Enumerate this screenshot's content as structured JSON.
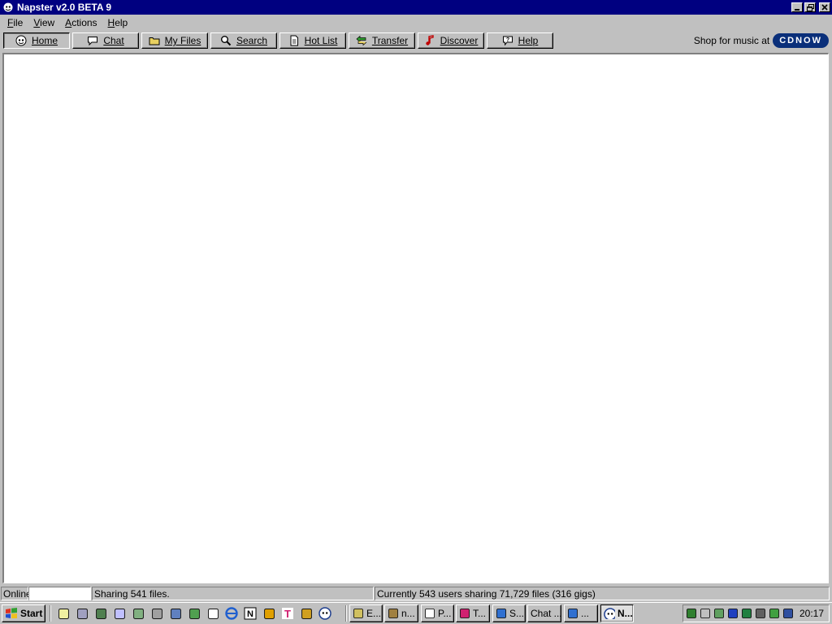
{
  "window": {
    "title": "Napster v2.0 BETA 9",
    "controls": [
      "minimize",
      "restore",
      "close"
    ]
  },
  "menu": [
    {
      "label": "File",
      "mnemonic": "F"
    },
    {
      "label": "View",
      "mnemonic": "V"
    },
    {
      "label": "Actions",
      "mnemonic": "A"
    },
    {
      "label": "Help",
      "mnemonic": "H"
    }
  ],
  "toolbar": {
    "buttons": [
      {
        "label": "Home",
        "icon": "napster-cat-icon",
        "active": true
      },
      {
        "label": "Chat",
        "icon": "speech-bubble-icon",
        "active": false
      },
      {
        "label": "My Files",
        "icon": "folder-icon",
        "active": false
      },
      {
        "label": "Search",
        "icon": "magnifier-icon",
        "active": false
      },
      {
        "label": "Hot List",
        "icon": "document-icon",
        "active": false
      },
      {
        "label": "Transfer",
        "icon": "transfer-arrows-icon",
        "active": false
      },
      {
        "label": "Discover",
        "icon": "music-note-icon",
        "active": false
      },
      {
        "label": "Help",
        "icon": "help-bubble-icon",
        "active": false
      }
    ],
    "shop_text": "Shop for music at",
    "shop_logo": "CDNOW"
  },
  "statusbar": {
    "connection": "Online",
    "sharing": "Sharing 541 files.",
    "network": "Currently 543 users sharing 71,729 files (316 gigs)"
  },
  "taskbar": {
    "start_label": "Start",
    "quicklaunch": [
      "notepad-icon",
      "computer-icon",
      "network-icon",
      "calendar-icon",
      "money-icon",
      "tools-icon",
      "monitor-icon",
      "gear-icon",
      "logitech-icon",
      "internet-explorer-icon",
      "netscape-icon",
      "winamp-icon",
      "t-icon",
      "pencil-icon",
      "napster-icon"
    ],
    "tasks": [
      {
        "label": "E...",
        "icon": "explorer-icon",
        "active": false
      },
      {
        "label": "n...",
        "icon": "tool-icon",
        "active": false
      },
      {
        "label": "P...",
        "icon": "document-icon",
        "active": false
      },
      {
        "label": "T...",
        "icon": "t-icon",
        "active": false
      },
      {
        "label": "S...",
        "icon": "ie-icon",
        "active": false
      },
      {
        "label": "Chat ...",
        "icon": "",
        "active": false
      },
      {
        "label": "...",
        "icon": "ie-icon",
        "active": false
      },
      {
        "label": "N...",
        "icon": "napster-icon",
        "active": true
      }
    ],
    "tray_icons": [
      "dragon-icon",
      "speaker-icon",
      "globe-icon",
      "eye-icon",
      "network-icon",
      "plug-icon",
      "virus-shield-icon",
      "napster-icon"
    ],
    "clock": "20:17"
  },
  "colors": {
    "titlebar": "#000080",
    "face": "#c0c0c0",
    "cdnow": "#0a2f7a"
  }
}
